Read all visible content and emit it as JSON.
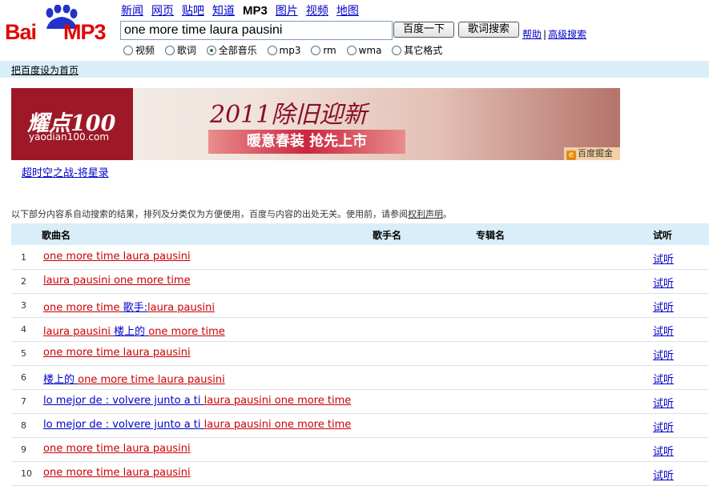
{
  "logo": {
    "bai": "Bai",
    "du": "du",
    "mp3": "MP3",
    "paw_color": "#2432c9"
  },
  "nav": [
    {
      "label": "新闻",
      "active": false
    },
    {
      "label": "网页",
      "active": false
    },
    {
      "label": "贴吧",
      "active": false
    },
    {
      "label": "知道",
      "active": false
    },
    {
      "label": "MP3",
      "active": true
    },
    {
      "label": "图片",
      "active": false
    },
    {
      "label": "视频",
      "active": false
    },
    {
      "label": "地图",
      "active": false
    }
  ],
  "search": {
    "value": "one more time laura pausini",
    "button": "百度一下",
    "lyrics_button": "歌词搜索"
  },
  "help": {
    "help": "帮助",
    "sep": "|",
    "advanced": "高级搜索"
  },
  "types": [
    {
      "label": "视频",
      "checked": false
    },
    {
      "label": "歌词",
      "checked": false
    },
    {
      "label": "全部音乐",
      "checked": true
    },
    {
      "label": "mp3",
      "checked": false
    },
    {
      "label": "rm",
      "checked": false
    },
    {
      "label": "wma",
      "checked": false
    },
    {
      "label": "其它格式",
      "checked": false
    }
  ],
  "home_link": "把百度设为首页",
  "banner": {
    "brand_name": "耀点100",
    "brand_url": "yaodian100.com",
    "headline": "2011除旧迎新",
    "promo": "暖意春装   抢先上市",
    "ad_tag": "百度掘金"
  },
  "ad_link": "超时空之战-将星录",
  "notice": {
    "text": "以下部分内容系自动搜索的结果，排列及分类仅为方便使用，百度与内容的出处无关。使用前，请参阅",
    "link": "权利声明",
    "end": "。"
  },
  "table": {
    "headers": {
      "song": "歌曲名",
      "artist": "歌手名",
      "album": "专辑名",
      "listen": "试听"
    },
    "rows": [
      {
        "num": "1",
        "parts": [
          {
            "t": "one more time laura pausini",
            "c": "red"
          }
        ],
        "listen": "试听"
      },
      {
        "num": "2",
        "parts": [
          {
            "t": "laura pausini one more time",
            "c": "red"
          }
        ],
        "listen": "试听"
      },
      {
        "num": "3",
        "parts": [
          {
            "t": "one more time ",
            "c": "red"
          },
          {
            "t": "歌手:",
            "c": "blue"
          },
          {
            "t": "laura pausini",
            "c": "red"
          }
        ],
        "listen": "试听"
      },
      {
        "num": "4",
        "parts": [
          {
            "t": "laura pausini ",
            "c": "red"
          },
          {
            "t": "楼上的 ",
            "c": "blue"
          },
          {
            "t": " one more time",
            "c": "red"
          }
        ],
        "listen": "试听"
      },
      {
        "num": "5",
        "parts": [
          {
            "t": "one more time laura pausini",
            "c": "red"
          }
        ],
        "listen": "试听"
      },
      {
        "num": "6",
        "parts": [
          {
            "t": "楼上的 ",
            "c": "blue"
          },
          {
            "t": " one more time laura pausini",
            "c": "red"
          }
        ],
        "listen": "试听"
      },
      {
        "num": "7",
        "parts": [
          {
            "t": "lo mejor de : volvere junto a ti ",
            "c": "blue"
          },
          {
            "t": "laura pausini one more time",
            "c": "red"
          }
        ],
        "listen": "试听"
      },
      {
        "num": "8",
        "parts": [
          {
            "t": "lo mejor de : volvere junto a ti ",
            "c": "blue"
          },
          {
            "t": "laura pausini one more time",
            "c": "red"
          }
        ],
        "listen": "试听"
      },
      {
        "num": "9",
        "parts": [
          {
            "t": "one more time laura pausini",
            "c": "red"
          }
        ],
        "listen": "试听"
      },
      {
        "num": "10",
        "parts": [
          {
            "t": "one more time laura pausini",
            "c": "red"
          }
        ],
        "listen": "试听"
      }
    ]
  }
}
